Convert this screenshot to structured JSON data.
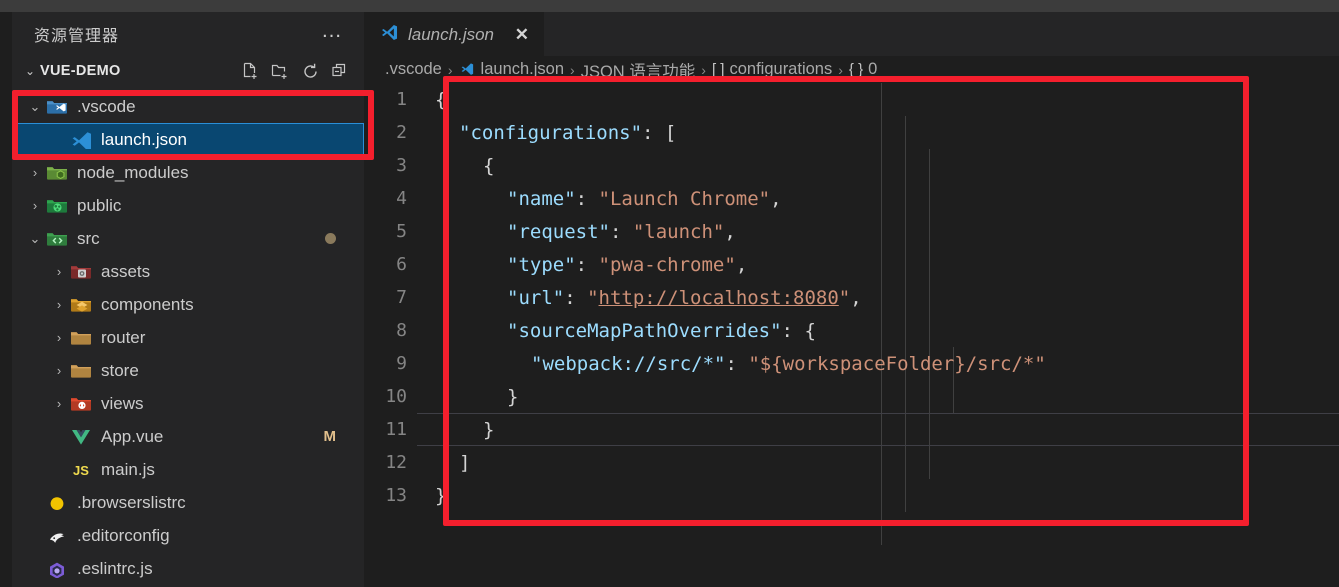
{
  "window": {
    "theme_bg": "#1e1e1e",
    "titlebar_color": "#3c3c3c"
  },
  "sidebar": {
    "title": "资源管理器",
    "more_actions_label": "…",
    "more_actions_icon": "ellipsis-icon",
    "section": {
      "chevron": "⌄",
      "name": "VUE-DEMO",
      "actions": [
        {
          "name": "new-file-icon",
          "tooltip": "新建文件"
        },
        {
          "name": "new-folder-icon",
          "tooltip": "新建文件夹"
        },
        {
          "name": "refresh-icon",
          "tooltip": "刷新"
        },
        {
          "name": "collapse-all-icon",
          "tooltip": "全部折叠"
        }
      ]
    },
    "tree": [
      {
        "label": ".vscode",
        "type": "folder",
        "twisty": "⌄",
        "expanded": true,
        "indent": 0,
        "icon": "vscode-folder-icon",
        "selected": false,
        "badge": ""
      },
      {
        "label": "launch.json",
        "type": "file",
        "twisty": "",
        "expanded": false,
        "indent": 1,
        "icon": "vscode-file-icon",
        "selected": true,
        "badge": ""
      },
      {
        "label": "node_modules",
        "type": "folder",
        "twisty": "›",
        "expanded": false,
        "indent": 0,
        "icon": "node-folder-icon",
        "selected": false,
        "badge": ""
      },
      {
        "label": "public",
        "type": "folder",
        "twisty": "›",
        "expanded": false,
        "indent": 0,
        "icon": "public-folder-icon",
        "selected": false,
        "badge": ""
      },
      {
        "label": "src",
        "type": "folder",
        "twisty": "⌄",
        "expanded": true,
        "indent": 0,
        "icon": "src-folder-icon",
        "selected": false,
        "badge": "dot"
      },
      {
        "label": "assets",
        "type": "folder",
        "twisty": "›",
        "expanded": false,
        "indent": 1,
        "icon": "assets-folder-icon",
        "selected": false,
        "badge": ""
      },
      {
        "label": "components",
        "type": "folder",
        "twisty": "›",
        "expanded": false,
        "indent": 1,
        "icon": "components-folder-icon",
        "selected": false,
        "badge": ""
      },
      {
        "label": "router",
        "type": "folder",
        "twisty": "›",
        "expanded": false,
        "indent": 1,
        "icon": "folder-icon",
        "selected": false,
        "badge": ""
      },
      {
        "label": "store",
        "type": "folder",
        "twisty": "›",
        "expanded": false,
        "indent": 1,
        "icon": "folder-icon",
        "selected": false,
        "badge": ""
      },
      {
        "label": "views",
        "type": "folder",
        "twisty": "›",
        "expanded": false,
        "indent": 1,
        "icon": "views-folder-icon",
        "selected": false,
        "badge": ""
      },
      {
        "label": "App.vue",
        "type": "file",
        "twisty": "",
        "expanded": false,
        "indent": 1,
        "icon": "vue-file-icon",
        "selected": false,
        "badge": "M"
      },
      {
        "label": "main.js",
        "type": "file",
        "twisty": "",
        "expanded": false,
        "indent": 1,
        "icon": "js-file-icon",
        "selected": false,
        "badge": ""
      },
      {
        "label": ".browserslistrc",
        "type": "file",
        "twisty": "",
        "expanded": false,
        "indent": 0,
        "icon": "browserslist-file-icon",
        "selected": false,
        "badge": ""
      },
      {
        "label": ".editorconfig",
        "type": "file",
        "twisty": "",
        "expanded": false,
        "indent": 0,
        "icon": "editorconfig-file-icon",
        "selected": false,
        "badge": ""
      },
      {
        "label": ".eslintrc.js",
        "type": "file",
        "twisty": "",
        "expanded": false,
        "indent": 0,
        "icon": "eslint-file-icon",
        "selected": false,
        "badge": ""
      }
    ]
  },
  "editor": {
    "tabs": [
      {
        "label": "launch.json",
        "icon": "vscode-file-icon",
        "close": "✕",
        "active": true,
        "italic": true
      }
    ],
    "breadcrumb": [
      {
        "text": ".vscode",
        "icon": ""
      },
      {
        "text": "launch.json",
        "icon": "vscode-file-icon"
      },
      {
        "text": "JSON 语言功能",
        "icon": ""
      },
      {
        "text": "configurations",
        "icon": "[ ]"
      },
      {
        "text": "0",
        "icon": "{ }"
      }
    ],
    "breadcrumb_separator": "›",
    "current_line": 11,
    "lines": [
      {
        "n": "1",
        "tokens": [
          {
            "t": "{",
            "c": "br"
          }
        ],
        "indent": 0
      },
      {
        "n": "2",
        "tokens": [
          {
            "t": "\"configurations\"",
            "c": "key"
          },
          {
            "t": ": ",
            "c": "pun"
          },
          {
            "t": "[",
            "c": "br"
          }
        ],
        "indent": 1
      },
      {
        "n": "3",
        "tokens": [
          {
            "t": "{",
            "c": "br"
          }
        ],
        "indent": 2
      },
      {
        "n": "4",
        "tokens": [
          {
            "t": "\"name\"",
            "c": "key"
          },
          {
            "t": ": ",
            "c": "pun"
          },
          {
            "t": "\"Launch Chrome\"",
            "c": "str"
          },
          {
            "t": ",",
            "c": "pun"
          }
        ],
        "indent": 3
      },
      {
        "n": "5",
        "tokens": [
          {
            "t": "\"request\"",
            "c": "key"
          },
          {
            "t": ": ",
            "c": "pun"
          },
          {
            "t": "\"launch\"",
            "c": "str"
          },
          {
            "t": ",",
            "c": "pun"
          }
        ],
        "indent": 3
      },
      {
        "n": "6",
        "tokens": [
          {
            "t": "\"type\"",
            "c": "key"
          },
          {
            "t": ": ",
            "c": "pun"
          },
          {
            "t": "\"pwa-chrome\"",
            "c": "str"
          },
          {
            "t": ",",
            "c": "pun"
          }
        ],
        "indent": 3
      },
      {
        "n": "7",
        "tokens": [
          {
            "t": "\"url\"",
            "c": "key"
          },
          {
            "t": ": ",
            "c": "pun"
          },
          {
            "t": "\"",
            "c": "str"
          },
          {
            "t": "http://localhost:8080",
            "c": "link"
          },
          {
            "t": "\"",
            "c": "str"
          },
          {
            "t": ",",
            "c": "pun"
          }
        ],
        "indent": 3
      },
      {
        "n": "8",
        "tokens": [
          {
            "t": "\"sourceMapPathOverrides\"",
            "c": "key"
          },
          {
            "t": ": ",
            "c": "pun"
          },
          {
            "t": "{",
            "c": "br"
          }
        ],
        "indent": 3
      },
      {
        "n": "9",
        "tokens": [
          {
            "t": "\"webpack://src/*\"",
            "c": "key"
          },
          {
            "t": ": ",
            "c": "pun"
          },
          {
            "t": "\"${workspaceFolder}/src/*\"",
            "c": "str"
          }
        ],
        "indent": 4
      },
      {
        "n": "10",
        "tokens": [
          {
            "t": "}",
            "c": "br"
          }
        ],
        "indent": 3
      },
      {
        "n": "11",
        "tokens": [
          {
            "t": "}",
            "c": "br"
          }
        ],
        "indent": 2
      },
      {
        "n": "12",
        "tokens": [
          {
            "t": "]",
            "c": "br"
          }
        ],
        "indent": 1
      },
      {
        "n": "13",
        "tokens": [
          {
            "t": "}",
            "c": "br"
          }
        ],
        "indent": 0
      }
    ]
  },
  "annotations": {
    "color": "#f41f2d",
    "boxes": [
      {
        "name": "sidebar-launch-json-highlight"
      },
      {
        "name": "editor-code-highlight"
      }
    ]
  }
}
